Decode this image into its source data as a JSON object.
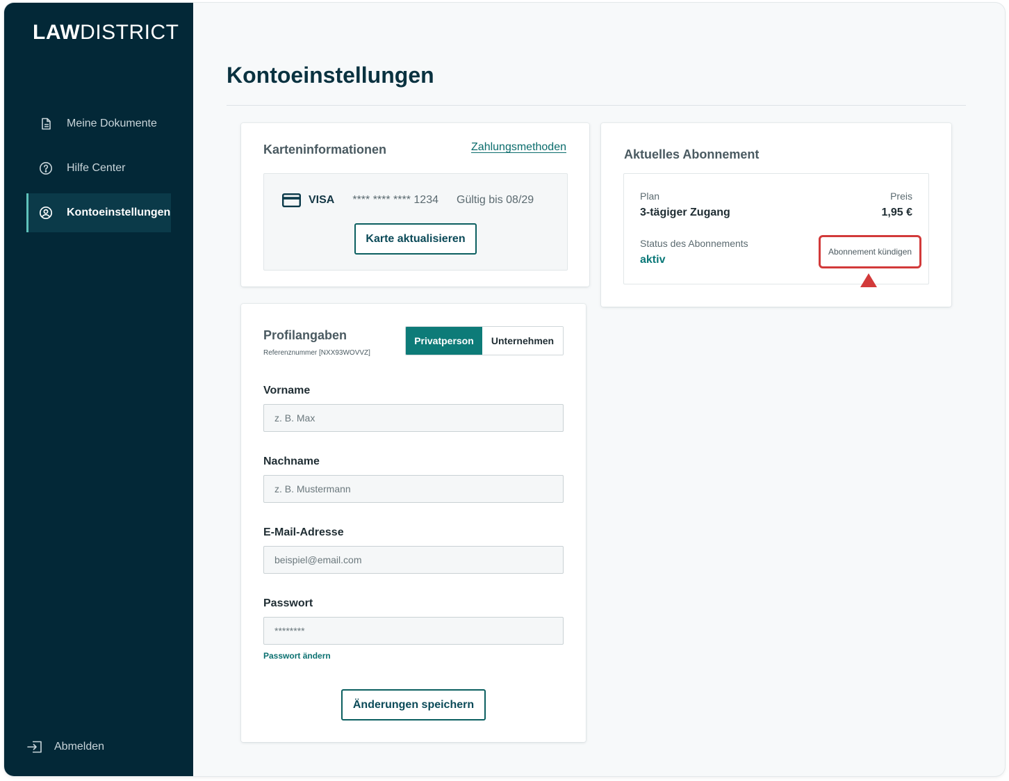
{
  "sidebar": {
    "logo_bold": "LAW",
    "logo_light": "DISTRICT",
    "items": [
      {
        "label": "Meine Dokumente",
        "icon": "document-icon"
      },
      {
        "label": "Hilfe Center",
        "icon": "help-circle-icon"
      },
      {
        "label": "Kontoeinstellungen",
        "icon": "user-circle-icon",
        "active": true
      }
    ],
    "logout_label": "Abmelden"
  },
  "page": {
    "title": "Kontoeinstellungen"
  },
  "card_info": {
    "heading": "Karteninformationen",
    "payment_methods_link": "Zahlungsmethoden",
    "brand": "VISA",
    "number_masked": "**** **** **** 1234",
    "valid_until": "Gültig bis 08/29",
    "update_button": "Karte aktualisieren"
  },
  "subscription": {
    "heading": "Aktuelles Abonnement",
    "plan_label": "Plan",
    "plan_value": "3-tägiger Zugang",
    "price_label": "Preis",
    "price_value": "1,95 €",
    "status_label": "Status des Abonnements",
    "status_value": "aktiv",
    "cancel_button": "Abonnement kündigen"
  },
  "profile": {
    "heading": "Profilangaben",
    "reference": "Referenznummer [NXX93WOVVZ]",
    "toggle": {
      "selected": "Privatperson",
      "other": "Unternehmen"
    },
    "fields": {
      "first_name": {
        "label": "Vorname",
        "placeholder": "z. B. Max"
      },
      "last_name": {
        "label": "Nachname",
        "placeholder": "z. B. Mustermann"
      },
      "email": {
        "label": "E-Mail-Adresse",
        "placeholder": "beispiel@email.com"
      },
      "password": {
        "label": "Passwort",
        "placeholder": "********"
      }
    },
    "change_password_link": "Passwort ändern",
    "save_button": "Änderungen speichern"
  },
  "colors": {
    "sidebar_bg": "#032837",
    "accent_teal": "#0d7b78",
    "highlight_red": "#d23a3a"
  }
}
